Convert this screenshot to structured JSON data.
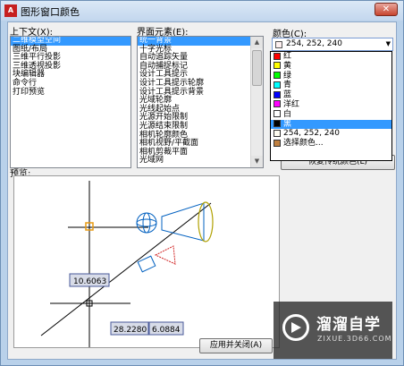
{
  "window": {
    "title": "图形窗口颜色",
    "close_symbol": "✕"
  },
  "context": {
    "label": "上下文(X):",
    "items": [
      "二维模型空间",
      "图纸/布局",
      "三维平行投影",
      "三维透视投影",
      "块编辑器",
      "命令行",
      "打印预览"
    ],
    "selected": 0
  },
  "interface_elements": {
    "label": "界面元素(E):",
    "items": [
      "统一背景",
      "十字光标",
      "自动追踪矢量",
      "自动捕捉标记",
      "设计工具提示",
      "设计工具提示轮廓",
      "设计工具提示背景",
      "光域轮廓",
      "光线起始点",
      "光源开始限制",
      "光源结束限制",
      "相机轮廓颜色",
      "相机视野/平截面",
      "相机剪裁平面",
      "光域网"
    ],
    "selected": 0
  },
  "color": {
    "label": "颜色(C):",
    "current": "254, 252, 240",
    "options": [
      {
        "name": "红",
        "color": "#ff0000"
      },
      {
        "name": "黄",
        "color": "#ffff00"
      },
      {
        "name": "绿",
        "color": "#00ff00"
      },
      {
        "name": "青",
        "color": "#00ffff"
      },
      {
        "name": "蓝",
        "color": "#0000ff"
      },
      {
        "name": "洋红",
        "color": "#ff00ff"
      },
      {
        "name": "白",
        "color": "#ffffff"
      },
      {
        "name": "黑",
        "color": "#000000"
      },
      {
        "name": "254, 252, 240",
        "color": "#fefcf0"
      },
      {
        "name": "选择颜色...",
        "color": "#c08040"
      }
    ],
    "highlighted": 7
  },
  "restore_button": "恢复传统颜色(L)",
  "preview": {
    "label": "预览:",
    "dim1": "10.6063",
    "dim2": "28.2280",
    "dim3": "6.0884"
  },
  "buttons": {
    "apply": "应用并关闭(A)"
  },
  "watermark": {
    "text": "溜溜自学",
    "sub": "ZIXUE.3D66.COM"
  }
}
